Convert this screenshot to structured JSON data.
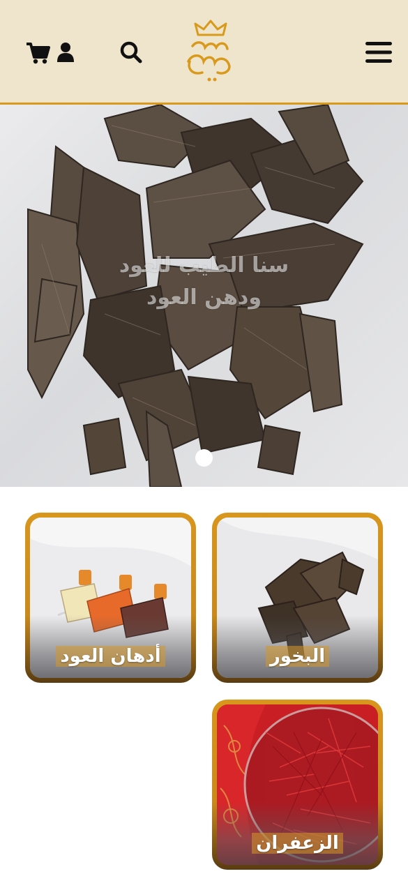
{
  "header": {
    "cart_icon": "cart-icon",
    "user_icon": "user-icon",
    "search_icon": "search-icon",
    "menu_icon": "menu-icon",
    "logo_text": "سنا الطيب",
    "colors": {
      "background": "#efe5cc",
      "accent": "#d99a1c"
    }
  },
  "hero": {
    "title_line1": "سنا الطيب للعود",
    "title_line2": "ودهن العود",
    "active_slide": 1
  },
  "categories": [
    {
      "label": "البخور"
    },
    {
      "label": "أدهان العود"
    },
    {
      "label": "الزعفران"
    }
  ]
}
